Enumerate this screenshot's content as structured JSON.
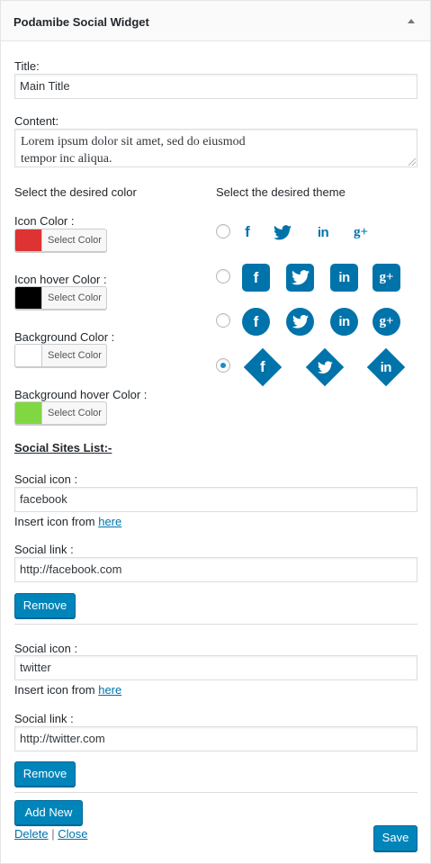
{
  "widget": {
    "title": "Podamibe Social Widget"
  },
  "title_field": {
    "label": "Title:",
    "value": "Main Title"
  },
  "content_field": {
    "label": "Content:",
    "value": "Lorem ipsum dolor sit amet, sed do eiusmod\ntempor inc aliqua."
  },
  "color_section": {
    "heading": "Select the desired color",
    "select_label": "Select Color",
    "icon_color": {
      "label": "Icon Color :",
      "color": "#dd3333"
    },
    "icon_hover_color": {
      "label": "Icon hover Color :",
      "color": "#000000"
    },
    "background_color": {
      "label": "Background Color :",
      "color": "#ffffff"
    },
    "background_hover_color": {
      "label": "Background hover Color :",
      "color": "#81d742"
    }
  },
  "theme_section": {
    "heading": "Select the desired theme",
    "selected": 4,
    "themes": [
      {
        "style": "plain",
        "icons": [
          "facebook-icon",
          "twitter-icon",
          "linkedin-icon",
          "google-plus-icon"
        ]
      },
      {
        "style": "square",
        "icons": [
          "facebook-icon",
          "twitter-icon",
          "linkedin-icon",
          "google-plus-icon"
        ]
      },
      {
        "style": "circle",
        "icons": [
          "facebook-icon",
          "twitter-icon",
          "linkedin-icon",
          "google-plus-icon"
        ]
      },
      {
        "style": "diamond",
        "icons": [
          "facebook-icon",
          "twitter-icon",
          "linkedin-icon"
        ]
      }
    ],
    "glyphs": {
      "facebook": "f",
      "linkedin": "in",
      "google_plus": "g+"
    },
    "accent": "#0073aa"
  },
  "social_list": {
    "heading": "Social Sites List:-",
    "icon_label": "Social icon :",
    "insert_text": "Insert icon from",
    "insert_link": "here",
    "link_label": "Social link :",
    "remove_label": "Remove",
    "items": [
      {
        "icon": "facebook",
        "link": "http://facebook.com"
      },
      {
        "icon": "twitter",
        "link": "http://twitter.com"
      }
    ]
  },
  "footer": {
    "add_new": "Add New",
    "delete": "Delete",
    "separator": "|",
    "close": "Close",
    "save": "Save"
  }
}
